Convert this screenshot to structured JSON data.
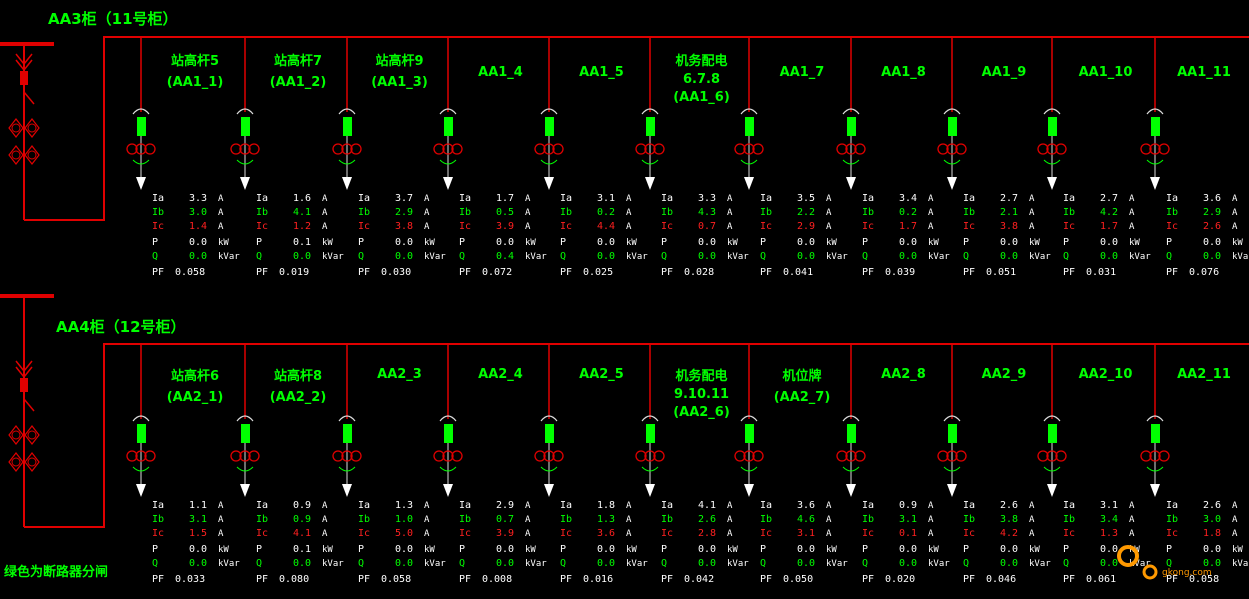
{
  "legend_text": "绿色为断路器分闸",
  "watermark_text": "gkong.com",
  "colors": {
    "bus": "#e00000",
    "breaker_open": "#00ff00",
    "text": "#00ff00",
    "background": "#000000"
  },
  "units": {
    "current": "A",
    "power": "kW",
    "reactive": "kVar"
  },
  "cabinets": [
    {
      "title": "AA3柜（11号柜）",
      "feeders": [
        {
          "name": [
            "站高杆5",
            "(AA1_1)"
          ],
          "Ia": "3.3",
          "Ib": "3.0",
          "Ic": "1.4",
          "P": "0.0",
          "Q": "0.0",
          "PF": "0.058"
        },
        {
          "name": [
            "站高杆7",
            "(AA1_2)"
          ],
          "Ia": "1.6",
          "Ib": "4.1",
          "Ic": "1.2",
          "P": "0.1",
          "Q": "0.0",
          "PF": "0.019"
        },
        {
          "name": [
            "站高杆9",
            "(AA1_3)"
          ],
          "Ia": "3.7",
          "Ib": "2.9",
          "Ic": "3.8",
          "P": "0.0",
          "Q": "0.0",
          "PF": "0.030"
        },
        {
          "name": [
            "AA1_4"
          ],
          "Ia": "1.7",
          "Ib": "0.5",
          "Ic": "3.9",
          "P": "0.0",
          "Q": "0.4",
          "PF": "0.072"
        },
        {
          "name": [
            "AA1_5"
          ],
          "Ia": "3.1",
          "Ib": "0.2",
          "Ic": "4.4",
          "P": "0.0",
          "Q": "0.0",
          "PF": "0.025"
        },
        {
          "name": [
            "机务配电",
            "6.7.8",
            "(AA1_6)"
          ],
          "Ia": "3.3",
          "Ib": "4.3",
          "Ic": "0.7",
          "P": "0.0",
          "Q": "0.0",
          "PF": "0.028"
        },
        {
          "name": [
            "AA1_7"
          ],
          "Ia": "3.5",
          "Ib": "2.2",
          "Ic": "2.9",
          "P": "0.0",
          "Q": "0.0",
          "PF": "0.041"
        },
        {
          "name": [
            "AA1_8"
          ],
          "Ia": "3.4",
          "Ib": "0.2",
          "Ic": "1.7",
          "P": "0.0",
          "Q": "0.0",
          "PF": "0.039"
        },
        {
          "name": [
            "AA1_9"
          ],
          "Ia": "2.7",
          "Ib": "2.1",
          "Ic": "3.8",
          "P": "0.0",
          "Q": "0.0",
          "PF": "0.051"
        },
        {
          "name": [
            "AA1_10"
          ],
          "Ia": "2.7",
          "Ib": "4.2",
          "Ic": "1.7",
          "P": "0.0",
          "Q": "0.0",
          "PF": "0.031"
        },
        {
          "name": [
            "AA1_11"
          ],
          "Ia": "3.6",
          "Ib": "2.9",
          "Ic": "2.6",
          "P": "0.0",
          "Q": "0.0",
          "PF": "0.076"
        }
      ]
    },
    {
      "title": "AA4柜（12号柜）",
      "feeders": [
        {
          "name": [
            "站高杆6",
            "(AA2_1)"
          ],
          "Ia": "1.1",
          "Ib": "3.1",
          "Ic": "1.5",
          "P": "0.0",
          "Q": "0.0",
          "PF": "0.033"
        },
        {
          "name": [
            "站高杆8",
            "(AA2_2)"
          ],
          "Ia": "0.9",
          "Ib": "0.9",
          "Ic": "4.1",
          "P": "0.1",
          "Q": "0.0",
          "PF": "0.080"
        },
        {
          "name": [
            "AA2_3"
          ],
          "Ia": "1.3",
          "Ib": "1.0",
          "Ic": "5.0",
          "P": "0.0",
          "Q": "0.0",
          "PF": "0.058"
        },
        {
          "name": [
            "AA2_4"
          ],
          "Ia": "2.9",
          "Ib": "0.7",
          "Ic": "3.9",
          "P": "0.0",
          "Q": "0.0",
          "PF": "0.008"
        },
        {
          "name": [
            "AA2_5"
          ],
          "Ia": "1.8",
          "Ib": "1.3",
          "Ic": "3.6",
          "P": "0.0",
          "Q": "0.0",
          "PF": "0.016"
        },
        {
          "name": [
            "机务配电",
            "9.10.11",
            "(AA2_6)"
          ],
          "Ia": "4.1",
          "Ib": "2.6",
          "Ic": "2.8",
          "P": "0.0",
          "Q": "0.0",
          "PF": "0.042"
        },
        {
          "name": [
            "机位牌",
            "(AA2_7)"
          ],
          "Ia": "3.6",
          "Ib": "4.6",
          "Ic": "3.1",
          "P": "0.0",
          "Q": "0.0",
          "PF": "0.050"
        },
        {
          "name": [
            "AA2_8"
          ],
          "Ia": "0.9",
          "Ib": "3.1",
          "Ic": "0.1",
          "P": "0.0",
          "Q": "0.0",
          "PF": "0.020"
        },
        {
          "name": [
            "AA2_9"
          ],
          "Ia": "2.6",
          "Ib": "3.8",
          "Ic": "4.2",
          "P": "0.0",
          "Q": "0.0",
          "PF": "0.046"
        },
        {
          "name": [
            "AA2_10"
          ],
          "Ia": "3.1",
          "Ib": "3.4",
          "Ic": "1.3",
          "P": "0.0",
          "Q": "0.0",
          "PF": "0.061"
        },
        {
          "name": [
            "AA2_11"
          ],
          "Ia": "2.6",
          "Ib": "3.0",
          "Ic": "1.8",
          "P": "0.0",
          "Q": "0.0",
          "PF": "0.058"
        }
      ]
    }
  ]
}
